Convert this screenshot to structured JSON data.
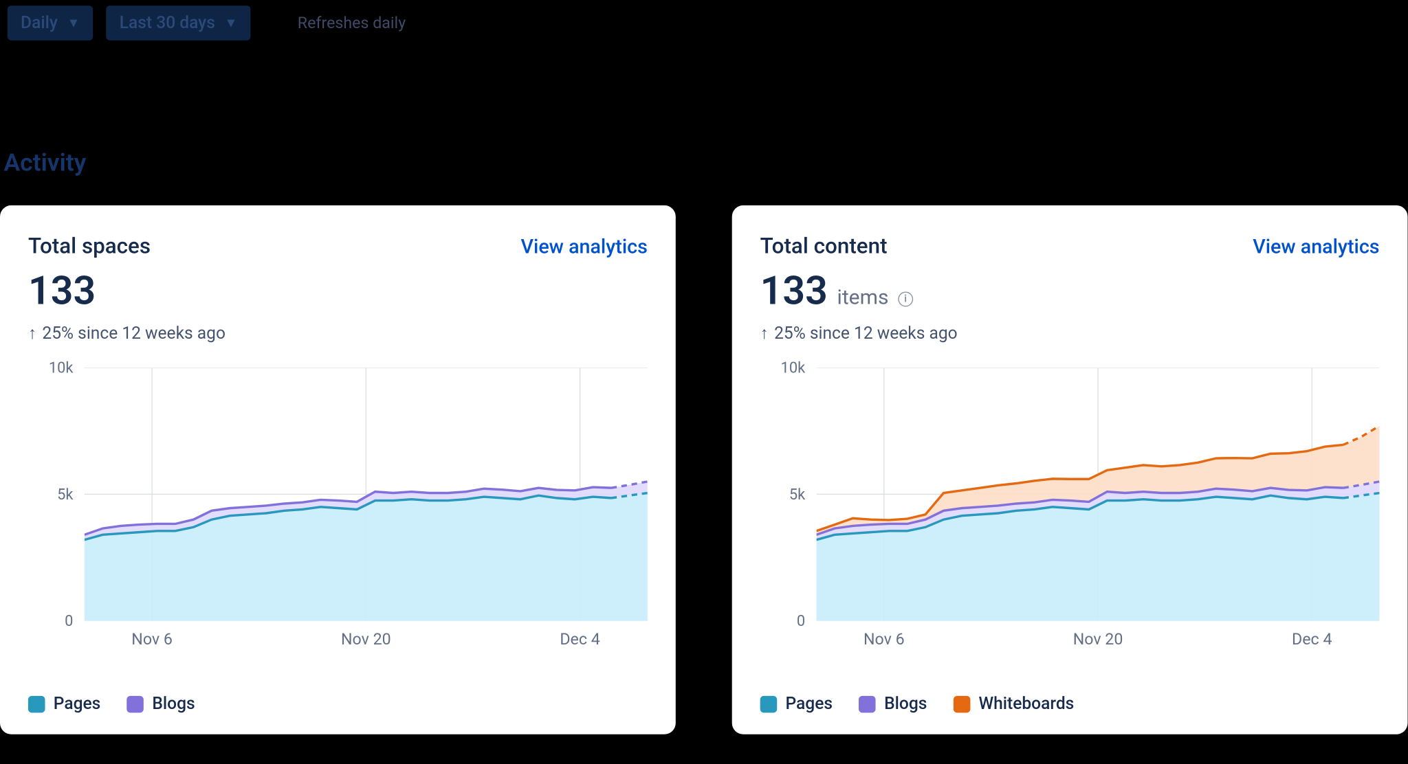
{
  "topbar": {
    "frequency": "Daily",
    "range": "Last 30 days",
    "refresh_note": "Refreshes daily"
  },
  "section_title": "Activity",
  "colors": {
    "pages_line": "#2898BD",
    "pages_fill": "#C6EDFB",
    "blogs_line": "#8270DB",
    "blogs_fill": "#DFD8FD",
    "whiteboards_line": "#E56910",
    "whiteboards_fill": "#FEDEC8",
    "link": "#0052CC"
  },
  "cards": [
    {
      "id": "total-spaces",
      "title": "Total spaces",
      "view_label": "View analytics",
      "metric_value": "133",
      "metric_unit": "",
      "has_info": false,
      "trend_text": "25% since 12 weeks ago",
      "ylabels": [
        "0",
        "5k",
        "10k"
      ],
      "xlabels": [
        "Nov 6",
        "Nov 20",
        "Dec 4"
      ],
      "legend": [
        {
          "name": "Pages",
          "color_key": "pages"
        },
        {
          "name": "Blogs",
          "color_key": "blogs"
        }
      ]
    },
    {
      "id": "total-content",
      "title": "Total content",
      "view_label": "View analytics",
      "metric_value": "133",
      "metric_unit": "items",
      "has_info": true,
      "trend_text": "25% since 12 weeks ago",
      "ylabels": [
        "0",
        "5k",
        "10k"
      ],
      "xlabels": [
        "Nov 6",
        "Nov 20",
        "Dec 4"
      ],
      "legend": [
        {
          "name": "Pages",
          "color_key": "pages"
        },
        {
          "name": "Blogs",
          "color_key": "blogs"
        },
        {
          "name": "Whiteboards",
          "color_key": "whiteboards"
        }
      ]
    }
  ],
  "chart_data": [
    {
      "type": "area",
      "title": "Total spaces",
      "ylabel": "",
      "ylim": [
        0,
        10000
      ],
      "x_ticks": [
        "Nov 6",
        "Nov 20",
        "Dec 4"
      ],
      "x": [
        0,
        1,
        2,
        3,
        4,
        5,
        6,
        7,
        8,
        9,
        10,
        11,
        12,
        13,
        14,
        15,
        16,
        17,
        18,
        19,
        20,
        21,
        22,
        23,
        24,
        25,
        26,
        27,
        28,
        29,
        30,
        31
      ],
      "series": [
        {
          "name": "Pages",
          "values": [
            3200,
            3400,
            3450,
            3500,
            3550,
            3550,
            3700,
            4000,
            4150,
            4200,
            4250,
            4350,
            4400,
            4500,
            4450,
            4400,
            4750,
            4750,
            4800,
            4750,
            4750,
            4800,
            4900,
            4850,
            4800,
            4950,
            4850,
            4800,
            4900,
            4850,
            4950,
            5050
          ]
        },
        {
          "name": "Blogs",
          "values": [
            200,
            250,
            300,
            300,
            280,
            280,
            300,
            350,
            300,
            300,
            300,
            280,
            280,
            280,
            300,
            300,
            350,
            300,
            300,
            300,
            300,
            300,
            320,
            330,
            320,
            300,
            320,
            350,
            380,
            400,
            420,
            450
          ]
        }
      ],
      "projection_from_index": 29
    },
    {
      "type": "area",
      "title": "Total content",
      "ylabel": "",
      "ylim": [
        0,
        10000
      ],
      "x_ticks": [
        "Nov 6",
        "Nov 20",
        "Dec 4"
      ],
      "x": [
        0,
        1,
        2,
        3,
        4,
        5,
        6,
        7,
        8,
        9,
        10,
        11,
        12,
        13,
        14,
        15,
        16,
        17,
        18,
        19,
        20,
        21,
        22,
        23,
        24,
        25,
        26,
        27,
        28,
        29,
        30,
        31
      ],
      "series": [
        {
          "name": "Pages",
          "values": [
            3200,
            3400,
            3450,
            3500,
            3550,
            3550,
            3700,
            4000,
            4150,
            4200,
            4250,
            4350,
            4400,
            4500,
            4450,
            4400,
            4750,
            4750,
            4800,
            4750,
            4750,
            4800,
            4900,
            4850,
            4800,
            4950,
            4850,
            4800,
            4900,
            4850,
            4950,
            5050
          ]
        },
        {
          "name": "Blogs",
          "values": [
            200,
            250,
            300,
            300,
            280,
            280,
            300,
            350,
            300,
            300,
            300,
            280,
            280,
            280,
            300,
            300,
            350,
            300,
            300,
            300,
            300,
            300,
            320,
            330,
            320,
            300,
            320,
            350,
            380,
            400,
            420,
            450
          ]
        },
        {
          "name": "Whiteboards",
          "values": [
            150,
            150,
            300,
            200,
            150,
            200,
            200,
            700,
            700,
            750,
            800,
            800,
            850,
            830,
            850,
            900,
            850,
            1000,
            1050,
            1050,
            1100,
            1150,
            1200,
            1250,
            1300,
            1350,
            1450,
            1550,
            1600,
            1700,
            1900,
            2200
          ]
        }
      ],
      "projection_from_index": 29
    }
  ]
}
